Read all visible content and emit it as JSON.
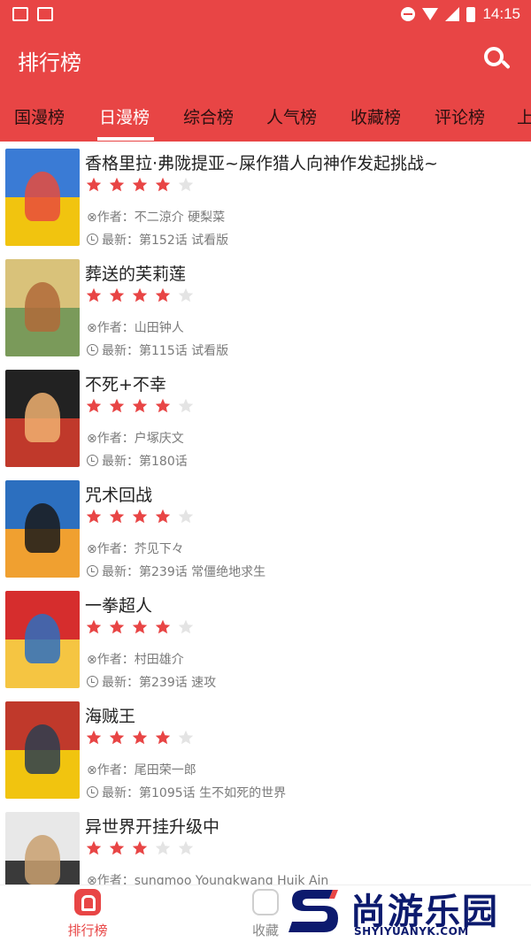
{
  "status_bar": {
    "time": "14:15",
    "left_icons": [
      "image-icon",
      "notification-icon"
    ],
    "right_icons": [
      "do-not-disturb-icon",
      "wifi-icon",
      "signal-icon",
      "battery-icon"
    ]
  },
  "app_bar": {
    "title": "排行榜",
    "search_icon": "search-icon"
  },
  "tabs": [
    {
      "label": "国漫榜",
      "active": false
    },
    {
      "label": "日漫榜",
      "active": true
    },
    {
      "label": "综合榜",
      "active": false
    },
    {
      "label": "人气榜",
      "active": false
    },
    {
      "label": "收藏榜",
      "active": false
    },
    {
      "label": "评论榜",
      "active": false
    },
    {
      "label": "上",
      "active": false
    }
  ],
  "rating_colors": {
    "filled": "#e84545",
    "empty": "#e4e4e4"
  },
  "items": [
    {
      "title": "香格里拉·弗陇提亚~屎作猎人向神作发起挑战~",
      "rating": 4,
      "author": "⊗作者：不二涼介 硬梨菜",
      "latest": "最新：第152话 试看版",
      "cover_colors": [
        "#3a7bd5",
        "#f1c40f",
        "#e74c3c"
      ]
    },
    {
      "title": "葬送的芙莉莲",
      "rating": 4,
      "author": "⊗作者：山田钟人",
      "latest": "最新：第115话 试看版",
      "cover_colors": [
        "#d9c27a",
        "#7a9a5a",
        "#b06a3a"
      ]
    },
    {
      "title": "不死+不幸",
      "rating": 4,
      "author": "⊗作者：户塚庆文",
      "latest": "最新：第180话",
      "cover_colors": [
        "#222222",
        "#c0392b",
        "#f0b070"
      ]
    },
    {
      "title": "咒术回战",
      "rating": 4,
      "author": "⊗作者：芥见下々",
      "latest": "最新：第239话 常僵绝地求生",
      "cover_colors": [
        "#2c6fbf",
        "#f0a030",
        "#1a1a1a"
      ]
    },
    {
      "title": "一拳超人",
      "rating": 4,
      "author": "⊗作者：村田雄介",
      "latest": "最新：第239话 速攻",
      "cover_colors": [
        "#d62d2d",
        "#f5c542",
        "#2d6fbf"
      ]
    },
    {
      "title": "海贼王",
      "rating": 4,
      "author": "⊗作者：尾田荣一郎",
      "latest": "最新：第1095话 生不如死的世界",
      "cover_colors": [
        "#c0392b",
        "#f1c40f",
        "#2c3e50"
      ]
    },
    {
      "title": "异世界开挂升级中",
      "rating": 3,
      "author": "⊗作者：sungmoo Youngkwang Huik Ain",
      "latest": "",
      "cover_colors": [
        "#e8e8e8",
        "#3a3a3a",
        "#c9a070"
      ]
    }
  ],
  "bottom_nav": [
    {
      "label": "排行榜",
      "icon": "ranking-icon",
      "active": true
    },
    {
      "label": "收藏",
      "icon": "favorite-icon",
      "active": false
    }
  ],
  "watermark": {
    "title": "尚游乐园",
    "subtitle": "SHYIYUANYK.COM",
    "colors": {
      "primary": "#0c1a6e",
      "accent": "#e84545"
    }
  }
}
